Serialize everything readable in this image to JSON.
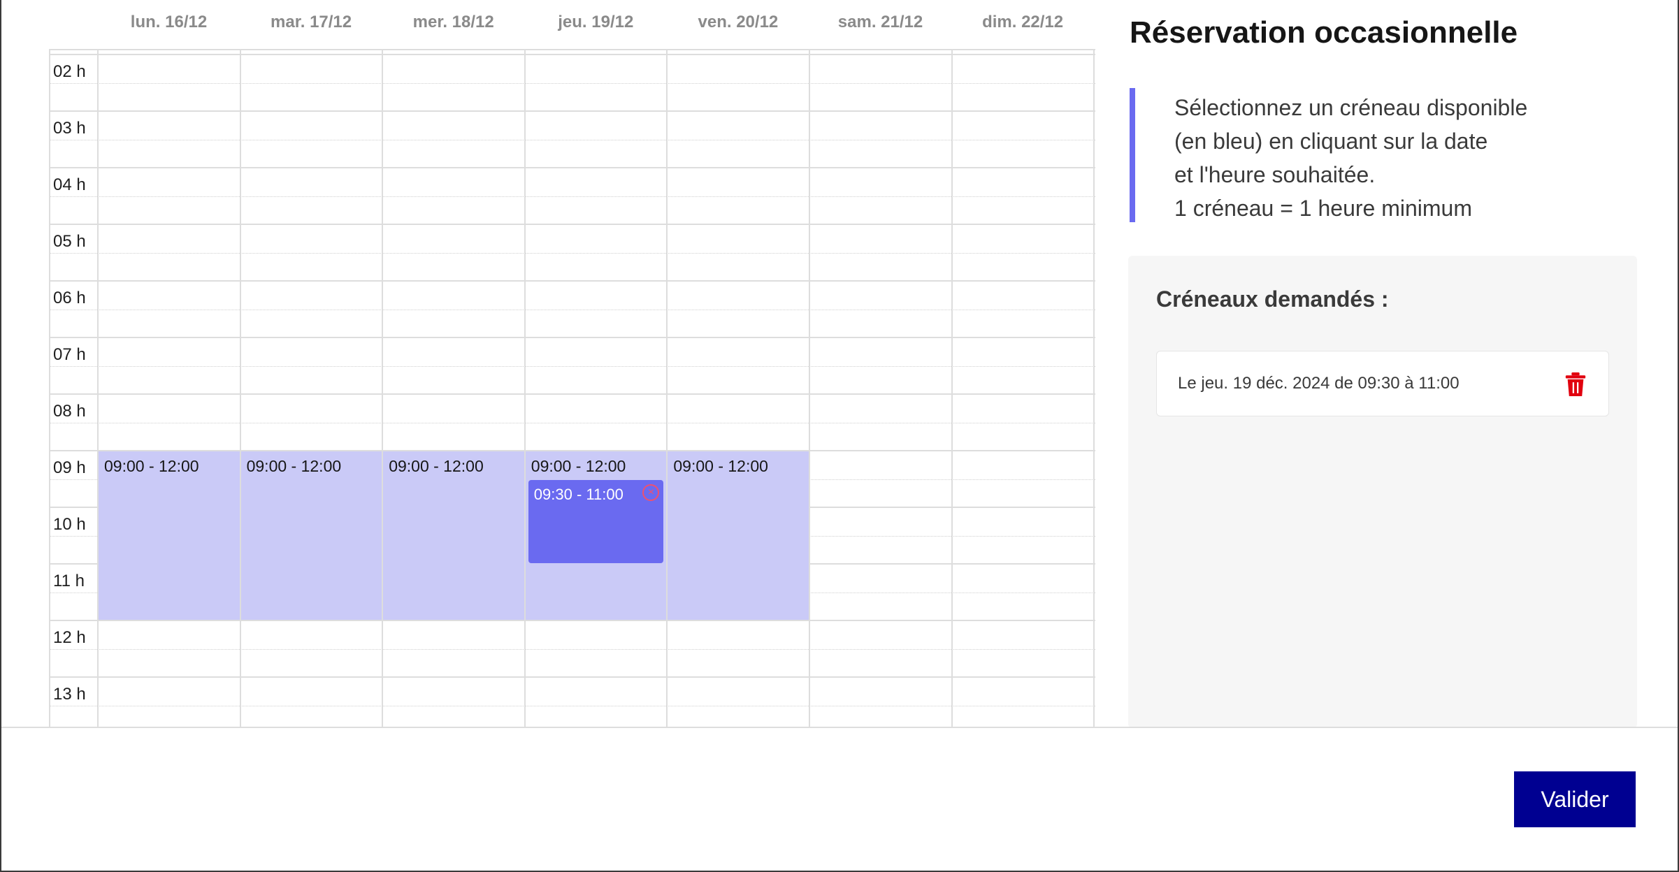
{
  "panel": {
    "title": "Réservation occasionnelle",
    "info_lines": [
      "Sélectionnez un créneau disponible",
      "(en bleu) en cliquant sur la date",
      "et l'heure souhaitée.",
      "1 créneau = 1 heure minimum"
    ],
    "requested_title": "Créneaux demandés :",
    "requested_items": [
      {
        "text": "Le jeu. 19 déc. 2024 de 09:30 à 11:00",
        "icon": "trash-icon"
      }
    ]
  },
  "calendar": {
    "days": [
      "lun. 16/12",
      "mar. 17/12",
      "mer. 18/12",
      "jeu. 19/12",
      "ven. 20/12",
      "sam. 21/12",
      "dim. 22/12"
    ],
    "hours": [
      "02 h",
      "03 h",
      "04 h",
      "05 h",
      "06 h",
      "07 h",
      "08 h",
      "09 h",
      "10 h",
      "11 h",
      "12 h",
      "13 h"
    ],
    "available_slots": [
      {
        "day": 0,
        "start": 9,
        "end": 12,
        "label": "09:00 - 12:00"
      },
      {
        "day": 1,
        "start": 9,
        "end": 12,
        "label": "09:00 - 12:00"
      },
      {
        "day": 2,
        "start": 9,
        "end": 12,
        "label": "09:00 - 12:00"
      },
      {
        "day": 3,
        "start": 9,
        "end": 12,
        "label": "09:00 - 12:00"
      },
      {
        "day": 4,
        "start": 9,
        "end": 12,
        "label": "09:00 - 12:00"
      }
    ],
    "booked_slots": [
      {
        "day": 3,
        "start": 9.5,
        "end": 11,
        "label": "09:30 - 11:00"
      }
    ],
    "colors": {
      "available": "#cacaf7",
      "booked": "#6a6af0",
      "accent": "#000091",
      "danger": "#f0506e"
    }
  },
  "footer": {
    "submit_label": "Valider"
  }
}
